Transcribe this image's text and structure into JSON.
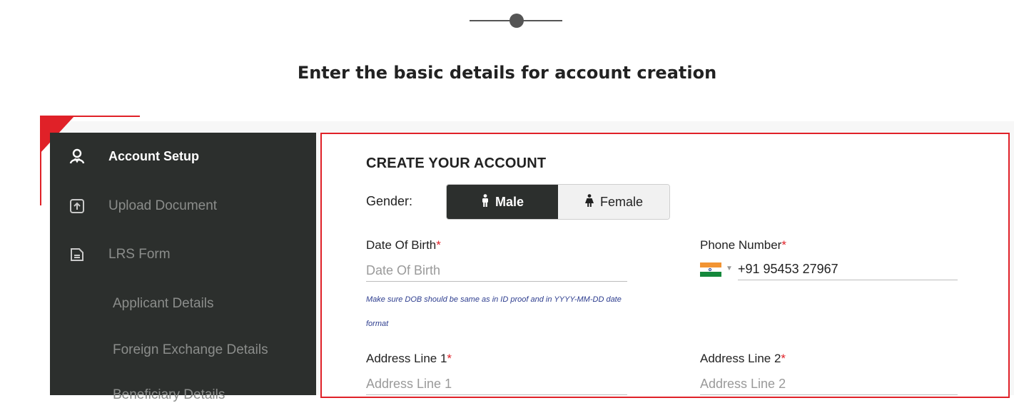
{
  "page": {
    "subtitle": "Enter the basic details for account creation"
  },
  "sidebar": {
    "items": [
      {
        "label": "Account Setup",
        "icon": "user-icon",
        "active": true
      },
      {
        "label": "Upload Document",
        "icon": "upload-icon",
        "active": false
      },
      {
        "label": "LRS Form",
        "icon": "document-icon",
        "active": false
      }
    ],
    "subitems": [
      {
        "label": "Applicant Details"
      },
      {
        "label": "Foreign Exchange Details"
      },
      {
        "label": "Beneficiary Details"
      }
    ]
  },
  "form": {
    "heading": "CREATE YOUR ACCOUNT",
    "gender": {
      "label": "Gender:",
      "options": [
        {
          "label": "Male",
          "icon": "male-icon",
          "selected": true
        },
        {
          "label": "Female",
          "icon": "female-icon",
          "selected": false
        }
      ]
    },
    "dob": {
      "label": "Date Of Birth",
      "required_mark": "*",
      "placeholder": "Date Of Birth",
      "value": "",
      "hint_line1": "Make sure DOB should be same as in ID proof and in YYYY-MM-DD date",
      "hint_line2": "format"
    },
    "phone": {
      "label": "Phone Number",
      "required_mark": "*",
      "country_icon": "india-flag-icon",
      "value": "+91 95453 27967"
    },
    "address1": {
      "label": "Address Line 1",
      "required_mark": "*",
      "placeholder": "Address Line 1",
      "value": ""
    },
    "address2": {
      "label": "Address Line 2",
      "required_mark": "*",
      "placeholder": "Address Line 2",
      "value": ""
    }
  },
  "colors": {
    "accent": "#e02128",
    "sidebar_bg": "#2c2f2d",
    "hint_text": "#2e3e8f"
  }
}
